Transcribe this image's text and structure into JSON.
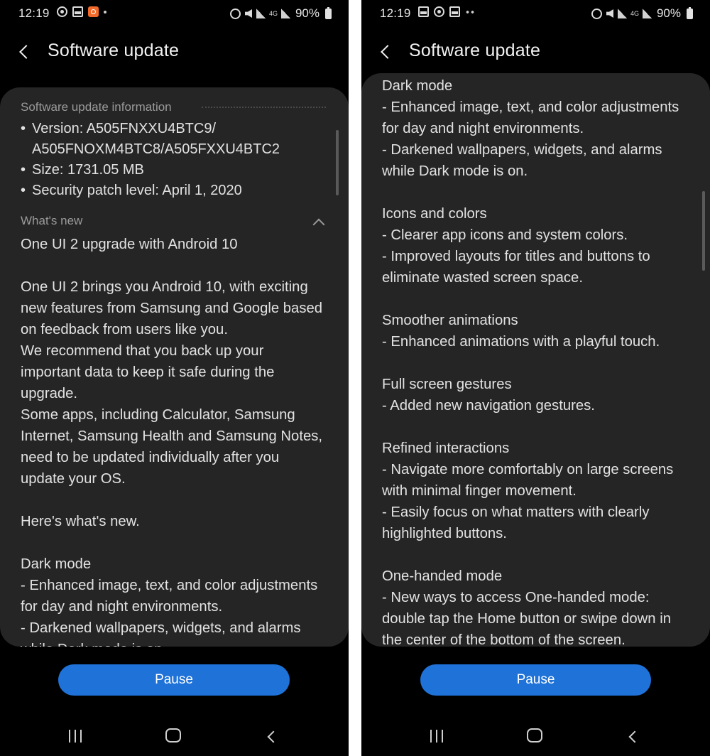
{
  "left": {
    "status": {
      "time": "12:19",
      "battery": "90%",
      "net_label": "4G"
    },
    "header": {
      "title": "Software update"
    },
    "info": {
      "header": "Software update information",
      "version_line1": "Version: A505FNXXU4BTC9/",
      "version_line2": "A505FNOXM4BTC8/A505FXXU4BTC2",
      "size": "Size: 1731.05 MB",
      "patch": "Security patch level: April 1, 2020"
    },
    "whats_new": {
      "header": "What's new",
      "body": "One UI 2 upgrade with Android 10\n\nOne UI 2 brings you Android 10, with exciting\nnew features from Samsung and Google based\non feedback from users like you.\nWe recommend that you back up your\nimportant data to keep it safe during the\nupgrade.\nSome apps, including Calculator, Samsung\nInternet, Samsung Health and Samsung Notes,\nneed to be updated individually after you\nupdate your OS.\n\nHere's what's new.\n\nDark mode\n- Enhanced image, text, and color adjustments\nfor day and night environments.\n- Darkened wallpapers, widgets, and alarms\nwhile Dark mode is on."
    },
    "pause_label": "Pause"
  },
  "right": {
    "status": {
      "time": "12:19",
      "battery": "90%",
      "net_label": "4G"
    },
    "header": {
      "title": "Software update"
    },
    "body": "Dark mode\n- Enhanced image, text, and color adjustments\nfor day and night environments.\n- Darkened wallpapers, widgets, and alarms\nwhile Dark mode is on.\n\nIcons and colors\n- Clearer app icons and system colors.\n- Improved layouts for titles and buttons to\neliminate wasted screen space.\n\nSmoother animations\n- Enhanced animations with a playful touch.\n\nFull screen gestures\n- Added new navigation gestures.\n\nRefined interactions\n- Navigate more comfortably on large screens\nwith minimal finger movement.\n- Easily focus on what matters with clearly\nhighlighted buttons.\n\nOne-handed mode\n- New ways to access One-handed mode:\ndouble tap the Home button or swipe down in\nthe center of the bottom of the screen.",
    "pause_label": "Pause"
  },
  "colors": {
    "background": "#000000",
    "card": "#252525",
    "accent_button": "#1e72d8",
    "text": "#e2e2e2",
    "section_header": "#9a9a9a"
  }
}
